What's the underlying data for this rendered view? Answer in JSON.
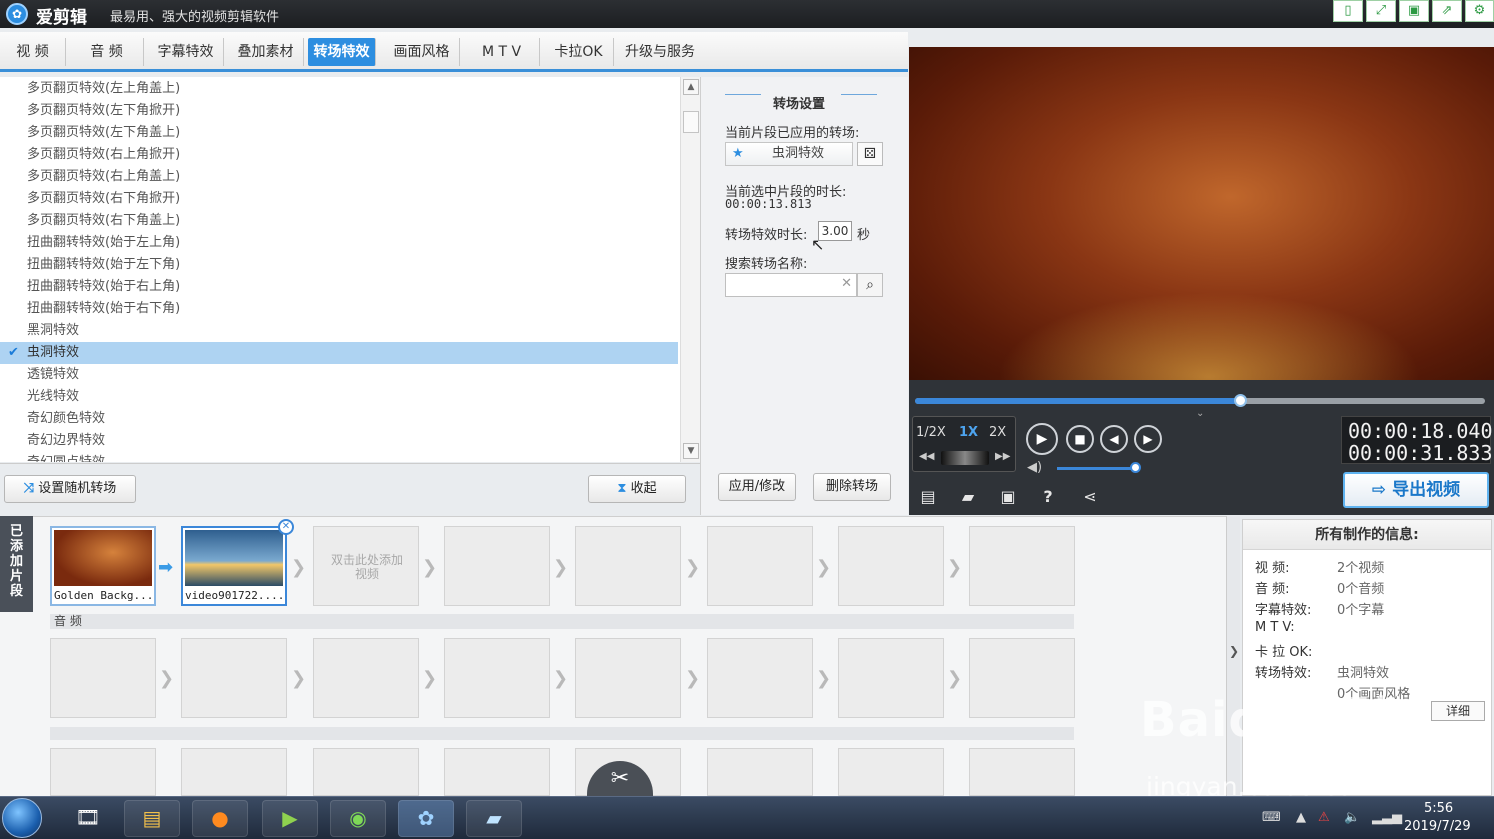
{
  "app": {
    "name": "爱剪辑",
    "slogan": "最易用、强大的视频剪辑软件"
  },
  "tabs": [
    "视 频",
    "音 频",
    "字幕特效",
    "叠加素材",
    "转场特效",
    "画面风格",
    "M T V",
    "卡拉OK",
    "升级与服务"
  ],
  "active_tab": "转场特效",
  "transitions": [
    "多页翻页特效(左上角盖上)",
    "多页翻页特效(左下角掀开)",
    "多页翻页特效(左下角盖上)",
    "多页翻页特效(右上角掀开)",
    "多页翻页特效(右上角盖上)",
    "多页翻页特效(右下角掀开)",
    "多页翻页特效(右下角盖上)",
    "扭曲翻转特效(始于左上角)",
    "扭曲翻转特效(始于左下角)",
    "扭曲翻转特效(始于右上角)",
    "扭曲翻转特效(始于右下角)",
    "黑洞特效",
    "虫洞特效",
    "透镜特效",
    "光线特效",
    "奇幻颜色特效",
    "奇幻边界特效",
    "奇幻圆点特效"
  ],
  "selected_transition": "虫洞特效",
  "left_buttons": {
    "random": "设置随机转场",
    "collapse": "收起"
  },
  "settings": {
    "title": "转场设置",
    "applied_label": "当前片段已应用的转场:",
    "applied_value": "虫洞特效",
    "clip_duration_label": "当前选中片段的时长:",
    "clip_duration_value": "00:00:13.813",
    "effect_duration_label": "转场特效时长:",
    "effect_duration_value": "3.00",
    "seconds_unit": "秒",
    "search_label": "搜索转场名称:",
    "search_value": "",
    "apply_button": "应用/修改",
    "delete_button": "删除转场"
  },
  "player": {
    "progress": 0.57,
    "speeds": [
      "1/2X",
      "1X",
      "2X"
    ],
    "active_speed": "1X",
    "current_time": "00:00:18.040",
    "total_time": "00:00:31.833",
    "volume": 0.95,
    "export_label": "导出视频"
  },
  "timeline": {
    "side_label": "已添加片段",
    "clips": [
      {
        "caption": "Golden Backg..."
      },
      {
        "caption": "video901722...."
      }
    ],
    "add_hint": "双击此处添加视频",
    "audio_label": "音 频"
  },
  "info": {
    "title": "所有制作的信息:",
    "rows": [
      {
        "k": "视    频:",
        "v": "2个视频"
      },
      {
        "k": "音    频:",
        "v": "0个音频"
      },
      {
        "k": "字幕特效:",
        "v": "0个字幕"
      },
      {
        "k": "M  T  V:",
        "v": ""
      },
      {
        "k": "卡 拉 OK:",
        "v": ""
      },
      {
        "k": "转场特效:",
        "v": "虫洞特效"
      },
      {
        "k": "",
        "v": "0个画面风格"
      }
    ],
    "detail_button": "详细"
  },
  "watermark": {
    "logo": "Baidu经验",
    "url": "jingyan.baidu.com"
  },
  "taskbar": {
    "time": "5:56",
    "date": "2019/7/29"
  },
  "colors": {
    "accent": "#2d8ee0",
    "selected_row": "#aed3f2",
    "player_bg": "#2f3338"
  }
}
